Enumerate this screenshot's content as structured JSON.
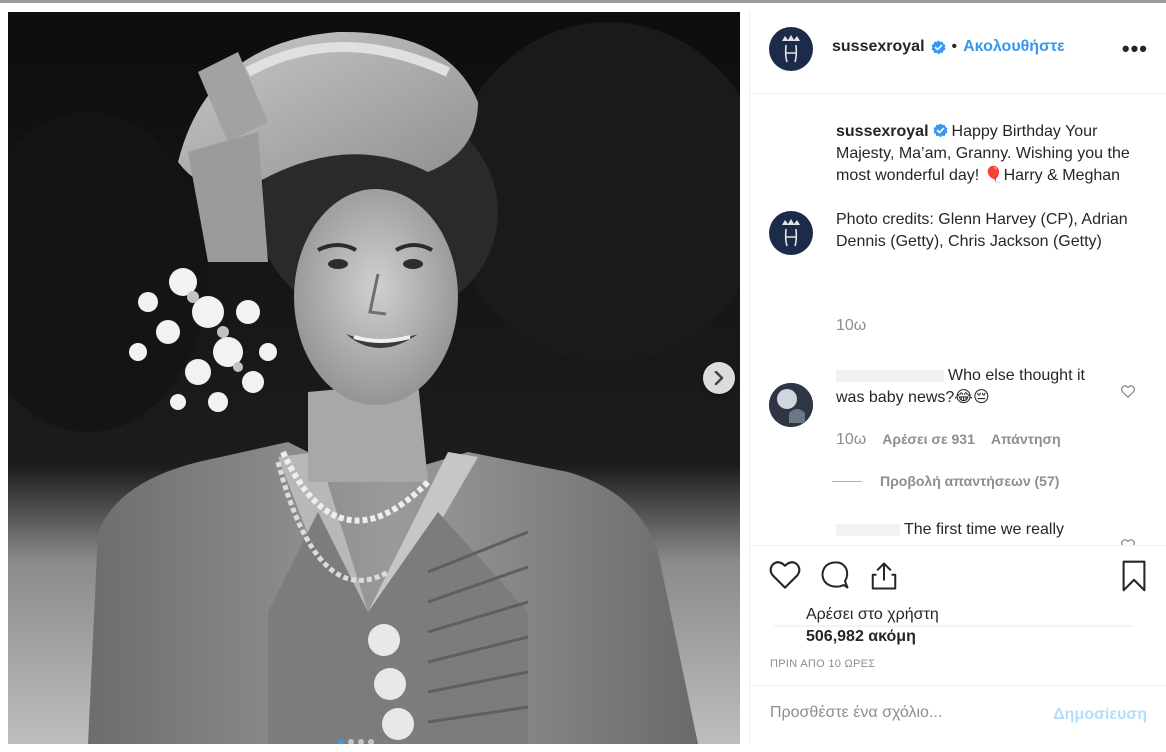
{
  "post": {
    "account": {
      "username": "sussexroyal",
      "verified": true,
      "follow_label": "Ακολουθήστε",
      "separator": "•",
      "more_label": "•••"
    },
    "caption": {
      "username": "sussexroyal",
      "text": "Happy Birthday Your Majesty, Ma’am, Granny. Wishing you the most wonderful day!",
      "emoji": "🎈",
      "signoff": "Harry & Meghan",
      "credits": "Photo credits: Glenn Harvey (CP), Adrian Dennis (Getty), Chris Jackson (Getty)",
      "time": "10ω"
    },
    "comments": [
      {
        "text": "Who else thought it was baby news?",
        "emoji": "😂😔",
        "time": "10ω",
        "likes_label": "Αρέσει σε 931",
        "reply_label": "Απάντηση"
      },
      {
        "text": "The first time we really"
      }
    ],
    "view_replies_label": "Προβολή απαντήσεων (57)",
    "likes": {
      "line1": "Αρέσει στο χρήστη",
      "count": "506,982 ακόμη"
    },
    "timestamp": "ΠΡΙΝ ΑΠΟ 10 ΩΡΕΣ",
    "add_comment": {
      "placeholder": "Προσθέστε ένα σχόλιο...",
      "post_label": "Δημοσίευση"
    },
    "carousel": {
      "slides": 4,
      "active_index": 0
    },
    "colors": {
      "accent": "#3897f0",
      "muted": "#8e8e8e",
      "post_disabled": "#b2dffc"
    },
    "icons": [
      "heart-icon",
      "comment-icon",
      "share-icon",
      "bookmark-icon",
      "verified-icon",
      "chevron-right-icon",
      "more-icon"
    ]
  }
}
